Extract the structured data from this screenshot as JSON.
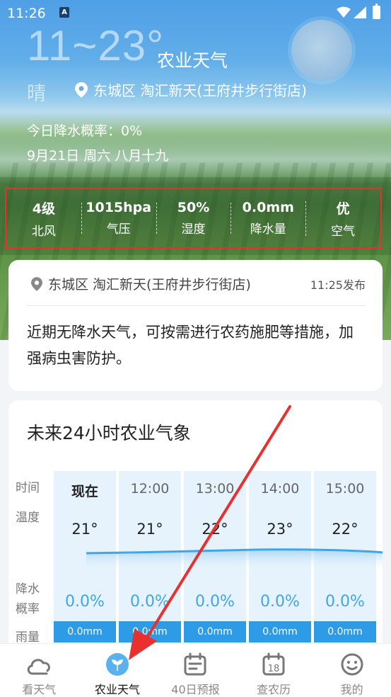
{
  "status_bar": {
    "time": "11:26",
    "notification_icon": "A"
  },
  "header": {
    "temp_range": "11~23°",
    "title": "农业天气",
    "weather": "晴",
    "location": "东城区 淘汇新天(王府井步行街店)"
  },
  "today": {
    "rain_probability": "今日降水概率：0%",
    "date": "9月21日 周六 八月十九"
  },
  "stats": [
    {
      "value": "4级",
      "label": "北风"
    },
    {
      "value": "1015hpa",
      "label": "气压"
    },
    {
      "value": "50%",
      "label": "湿度"
    },
    {
      "value": "0.0mm",
      "label": "降水量"
    },
    {
      "value": "优",
      "label": "空气"
    }
  ],
  "advisory": {
    "location": "东城区 淘汇新天(王府井步行街店)",
    "published": "11:25发布",
    "text": "近期无降水天气，可按需进行农药施肥等措施，加强病虫害防护。"
  },
  "forecast": {
    "title": "未来24小时农业气象",
    "row_labels": {
      "time": "时间",
      "temp": "温度",
      "prob_1": "降水",
      "prob_2": "概率",
      "rain": "雨量"
    },
    "hours": [
      {
        "time": "现在",
        "temp": "21°",
        "prob": "0.0%",
        "rain": "0.0mm"
      },
      {
        "time": "12:00",
        "temp": "21°",
        "prob": "0.0%",
        "rain": "0.0mm"
      },
      {
        "time": "13:00",
        "temp": "22°",
        "prob": "0.0%",
        "rain": "0.0mm"
      },
      {
        "time": "14:00",
        "temp": "23°",
        "prob": "0.0%",
        "rain": "0.0mm"
      },
      {
        "time": "15:00",
        "temp": "22°",
        "prob": "0.0%",
        "rain": "0.0mm"
      }
    ]
  },
  "nav": [
    {
      "label": "看天气",
      "icon": "cloud-icon"
    },
    {
      "label": "农业天气",
      "icon": "sprout-icon"
    },
    {
      "label": "40日预报",
      "icon": "calendar-icon"
    },
    {
      "label": "查农历",
      "icon": "almanac-icon",
      "day": "18"
    },
    {
      "label": "我的",
      "icon": "smiley-icon"
    }
  ],
  "colors": {
    "accent": "#2e9be6",
    "highlight_border": "#e8302f",
    "annotation_arrow": "#e8302f"
  }
}
